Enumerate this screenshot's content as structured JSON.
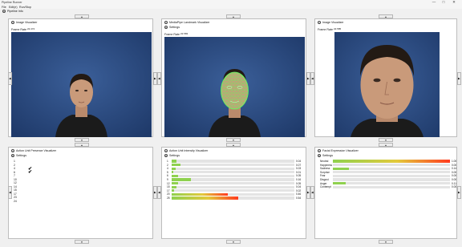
{
  "window": {
    "title": "Pipeline Runner",
    "controls": [
      "—",
      "□",
      "✕"
    ]
  },
  "menu": [
    "File",
    "Edit(e)",
    "Run/Stop"
  ],
  "pipeline_info_label": "Pipeline Info",
  "nav_arrows": {
    "up": "▲",
    "down": "▼",
    "left": "◀",
    "right": "▶"
  },
  "panels": {
    "image1": {
      "title": "Image Visualizer",
      "frame_rate_label": "Frame Rate",
      "frame_rate": "22.474"
    },
    "landmark": {
      "title": "MediaPipe Landmark Visualizer",
      "settings_label": "Settings",
      "frame_rate_label": "Frame Rate",
      "frame_rate": "22.583"
    },
    "image2": {
      "title": "Image Visualizer",
      "frame_rate_label": "Frame Rate",
      "frame_rate": "22.585"
    },
    "au_presence": {
      "title": "Action Unit Presence Visualizer",
      "settings_label": "Settings",
      "rows": [
        {
          "au": "1",
          "checked": false
        },
        {
          "au": "2",
          "checked": false
        },
        {
          "au": "4",
          "checked": true
        },
        {
          "au": "6",
          "checked": true
        },
        {
          "au": "7",
          "checked": false
        },
        {
          "au": "10",
          "checked": false
        },
        {
          "au": "12",
          "checked": false
        },
        {
          "au": "14",
          "checked": false
        },
        {
          "au": "15",
          "checked": false
        },
        {
          "au": "17",
          "checked": false
        },
        {
          "au": "23",
          "checked": false
        },
        {
          "au": "24",
          "checked": false
        }
      ]
    },
    "au_intensity": {
      "title": "Action Unit Intensity Visualizer",
      "settings_label": "Settings",
      "rows": [
        {
          "au": "1",
          "value": 0.04,
          "label": "0.04"
        },
        {
          "au": "2",
          "value": 0.07,
          "label": "0.07"
        },
        {
          "au": "4",
          "value": 0.03,
          "label": "0.03"
        },
        {
          "au": "5",
          "value": 0.01,
          "label": "0.01"
        },
        {
          "au": "6",
          "value": 0.05,
          "label": "0.05"
        },
        {
          "au": "9",
          "value": 0.16,
          "label": "0.16"
        },
        {
          "au": "12",
          "value": 0.05,
          "label": "0.05"
        },
        {
          "au": "15",
          "value": 0.04,
          "label": "0.04"
        },
        {
          "au": "17",
          "value": 0.02,
          "label": "0.02"
        },
        {
          "au": "20",
          "value": 0.46,
          "label": "0.46"
        },
        {
          "au": "25",
          "value": 0.54,
          "label": "0.54"
        }
      ]
    },
    "expression": {
      "title": "Facial Expression Visualizer",
      "settings_label": "Settings",
      "rows": [
        {
          "name": "Neutral",
          "value": 1.0,
          "label": "1.00"
        },
        {
          "name": "Happiness",
          "value": 0.0,
          "label": "0.00"
        },
        {
          "name": "Sadness",
          "value": 0.14,
          "label": "0.14"
        },
        {
          "name": "Surprise",
          "value": 0.0,
          "label": "0.00"
        },
        {
          "name": "Fear",
          "value": 0.0,
          "label": "0.00"
        },
        {
          "name": "Disgust",
          "value": 0.0,
          "label": "0.00"
        },
        {
          "name": "Anger",
          "value": 0.11,
          "label": "0.11"
        },
        {
          "name": "Contempt",
          "value": 0.0,
          "label": "0.00"
        }
      ]
    }
  },
  "colors": {
    "video_background": "#2e4f86",
    "landmark_mesh": "#5cff5c",
    "bar_start": "#8fd14f",
    "bar_end": "#ff3b1f",
    "track": "#e4e4e4"
  }
}
